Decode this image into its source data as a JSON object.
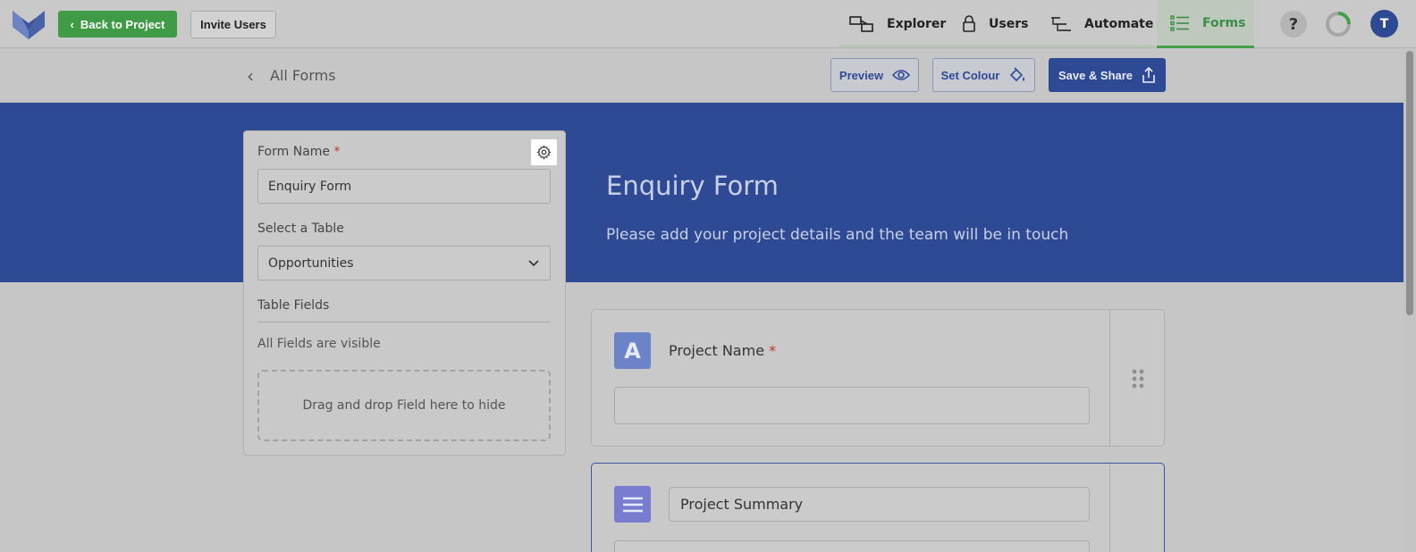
{
  "topnav": {
    "back_label": "Back to Project",
    "invite_label": "Invite Users",
    "tabs": [
      {
        "label": "Explorer",
        "icon": "explorer-icon"
      },
      {
        "label": "Users",
        "icon": "lock-icon"
      },
      {
        "label": "Automate",
        "icon": "automate-icon"
      },
      {
        "label": "Forms",
        "icon": "forms-icon",
        "active": true
      }
    ],
    "help_label": "?",
    "avatar_initial": "T",
    "accent_color": "#43a047",
    "brand_color": "#2f4a95"
  },
  "subheader": {
    "back_label": "All Forms",
    "preview_label": "Preview",
    "set_colour_label": "Set Colour",
    "save_label": "Save & Share"
  },
  "banner": {
    "title": "Enquiry Form",
    "description": "Please add your project details and the team will be in touch"
  },
  "panel": {
    "form_name_label": "Form Name",
    "required_mark": "*",
    "form_name_value": "Enquiry Form",
    "select_table_label": "Select a Table",
    "select_table_value": "Opportunities",
    "table_fields_label": "Table Fields",
    "visibility_text": "All Fields are visible",
    "dropzone_text": "Drag and drop Field here to hide"
  },
  "fields": [
    {
      "icon_text": "A",
      "label": "Project Name",
      "required_mark": "*"
    },
    {
      "label": "Project Summary"
    }
  ]
}
